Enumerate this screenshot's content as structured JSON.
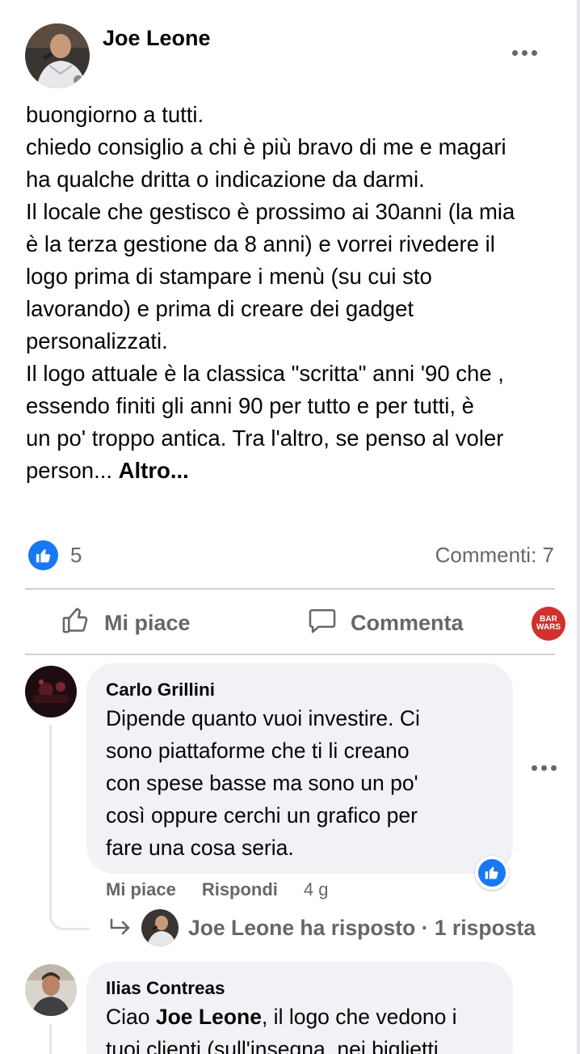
{
  "post": {
    "author": "Joe Leone",
    "lines": [
      "buongiorno a tutti.",
      "chiedo consiglio a chi è più bravo di me e magari",
      "ha qualche dritta o indicazione da darmi.",
      "Il locale che gestisco è prossimo ai 30anni (la mia",
      "è la terza gestione da 8 anni) e vorrei rivedere il",
      "logo prima di stampare i menù (su cui sto",
      "lavorando) e prima di creare dei gadget",
      "personalizzati.",
      "Il logo attuale è la classica \"scritta\" anni '90 che ,",
      "essendo finiti gli anni 90 per tutto e per tutti, è",
      "un po' troppo antica. Tra l'altro, se penso al voler"
    ],
    "last_line": "person... ",
    "see_more": "Altro..."
  },
  "reactions": {
    "like_count": "5",
    "comments": "Commenti: 7"
  },
  "actions": {
    "like": "Mi piace",
    "comment": "Commenta"
  },
  "page_badge": {
    "line1": "BAR",
    "line2": "WARS"
  },
  "comments": [
    {
      "author": "Carlo Grillini",
      "lines": [
        "Dipende quanto vuoi investire. Ci",
        "sono piattaforme che ti li creano",
        "con spese basse ma sono un po'",
        "così oppure cerchi un grafico per",
        "fare una cosa seria."
      ],
      "like_label": "Mi piace",
      "reply_label": "Rispondi",
      "age": "4 g",
      "replies_summary": "Joe Leone ha risposto · 1 risposta"
    },
    {
      "author": "Ilias Contreas",
      "line1_prefix": "Ciao ",
      "line1_mention": "Joe Leone",
      "line1_suffix": ", il logo che vedono i",
      "line2": "tuoi clienti (sull'insegna, nei biglietti"
    }
  ],
  "colors": {
    "accent": "#1877f2",
    "secondary_text": "#65676b",
    "bubble_bg": "#f0f2f5",
    "badge_red": "#d0312d"
  }
}
